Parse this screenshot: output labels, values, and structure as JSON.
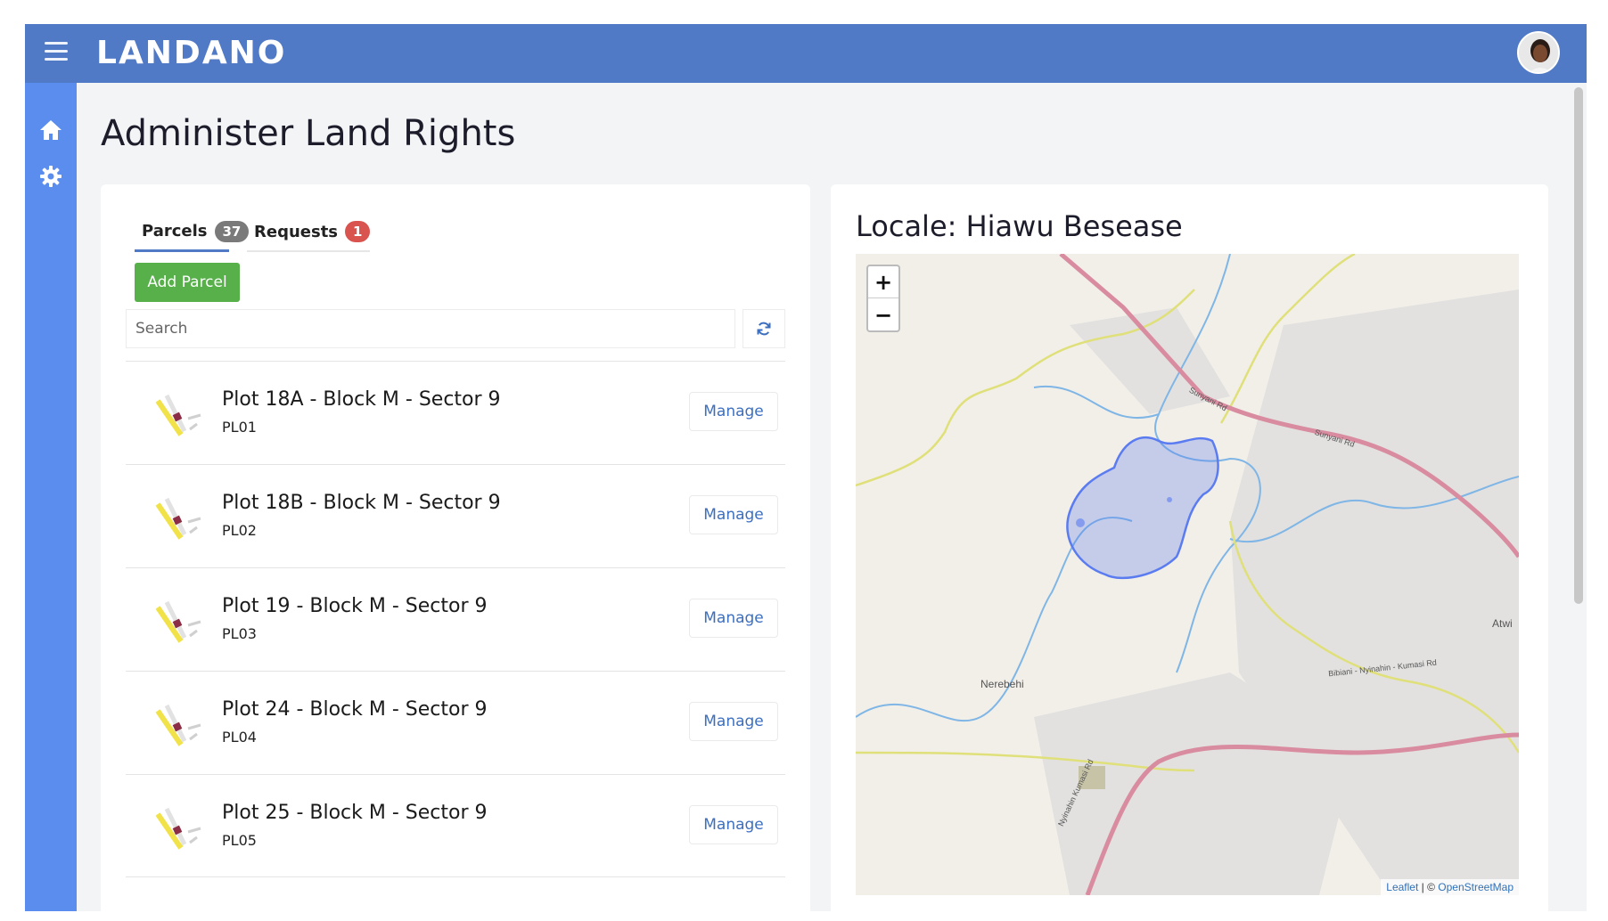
{
  "app": {
    "brand": "LANDANO"
  },
  "page": {
    "title": "Administer Land Rights"
  },
  "tabs": [
    {
      "label": "Parcels",
      "badge": "37"
    },
    {
      "label": "Requests",
      "badge": "1"
    }
  ],
  "toolbar": {
    "add_label": "Add Parcel",
    "search_placeholder": "Search"
  },
  "parcels": [
    {
      "title": "Plot 18A - Block M - Sector 9",
      "code": "PL01",
      "action": "Manage"
    },
    {
      "title": "Plot 18B - Block M - Sector 9",
      "code": "PL02",
      "action": "Manage"
    },
    {
      "title": "Plot 19 - Block M - Sector 9",
      "code": "PL03",
      "action": "Manage"
    },
    {
      "title": "Plot 24 - Block M - Sector 9",
      "code": "PL04",
      "action": "Manage"
    },
    {
      "title": "Plot 25 - Block M - Sector 9",
      "code": "PL05",
      "action": "Manage"
    }
  ],
  "map": {
    "title": "Locale: Hiawu Besease",
    "zoom_in": "+",
    "zoom_out": "−",
    "attribution_leaflet": "Leaflet",
    "attribution_sep": " | © ",
    "attribution_osm": "OpenStreetMap",
    "labels": {
      "road1": "Sunyani Rd",
      "road2": "Sunyani Rd",
      "town1": "Nerebehi",
      "town2": "Atwi",
      "road3": "Bibiani - Nyinahin - Kumasi Rd",
      "road4": "Nyinahin Kumasi Rd"
    }
  },
  "colors": {
    "topbar": "#5079c6",
    "sidebar": "#5b8def",
    "add_button": "#57b04a",
    "badge_count": "#7a7a7a",
    "badge_alert": "#d9534f",
    "polygon": "#5b7cf0"
  },
  "icons": {
    "menu": "hamburger-menu-icon",
    "home": "home-icon",
    "settings": "gear-icon",
    "refresh": "refresh-icon",
    "parcel": "parcel-map-thumbnail-icon"
  }
}
